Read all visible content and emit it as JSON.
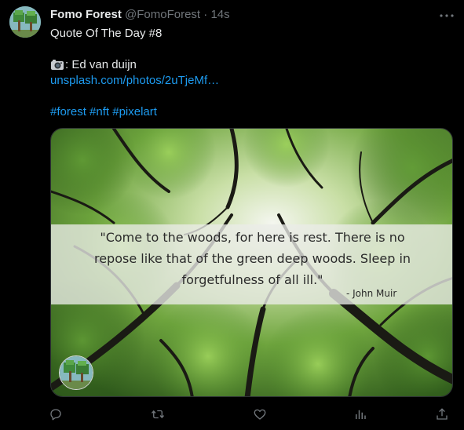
{
  "author": {
    "name": "Fomo Forest",
    "handle": "@FomoForest",
    "separator": "·",
    "time": "14s",
    "avatar_icon": "pixel-tree-avatar"
  },
  "tweet": {
    "line1": "Quote Of The Day #8",
    "credit_prefix": ": Ed van duijn",
    "credit_icon": "camera-icon",
    "link_text": "unsplash.com/photos/2uTjeMf…",
    "hashtags": [
      "#forest",
      "#nft",
      "#pixelart"
    ]
  },
  "media": {
    "quote": "\"Come to the woods, for here is rest. There is no repose like that of the green deep woods. Sleep in forgetfulness of all ill.\"",
    "quote_lines": [
      "\"Come to the woods, for here is rest. There is no",
      "repose like that of the green deep woods. Sleep in",
      "forgetfulness of all ill.\""
    ],
    "attribution": "- John Muir"
  },
  "actions": [
    "reply-icon",
    "retweet-icon",
    "like-icon",
    "views-icon",
    "share-icon"
  ],
  "colors": {
    "background": "#000000",
    "text": "#e7e9ea",
    "muted": "#71767b",
    "link": "#1d9bf0"
  }
}
